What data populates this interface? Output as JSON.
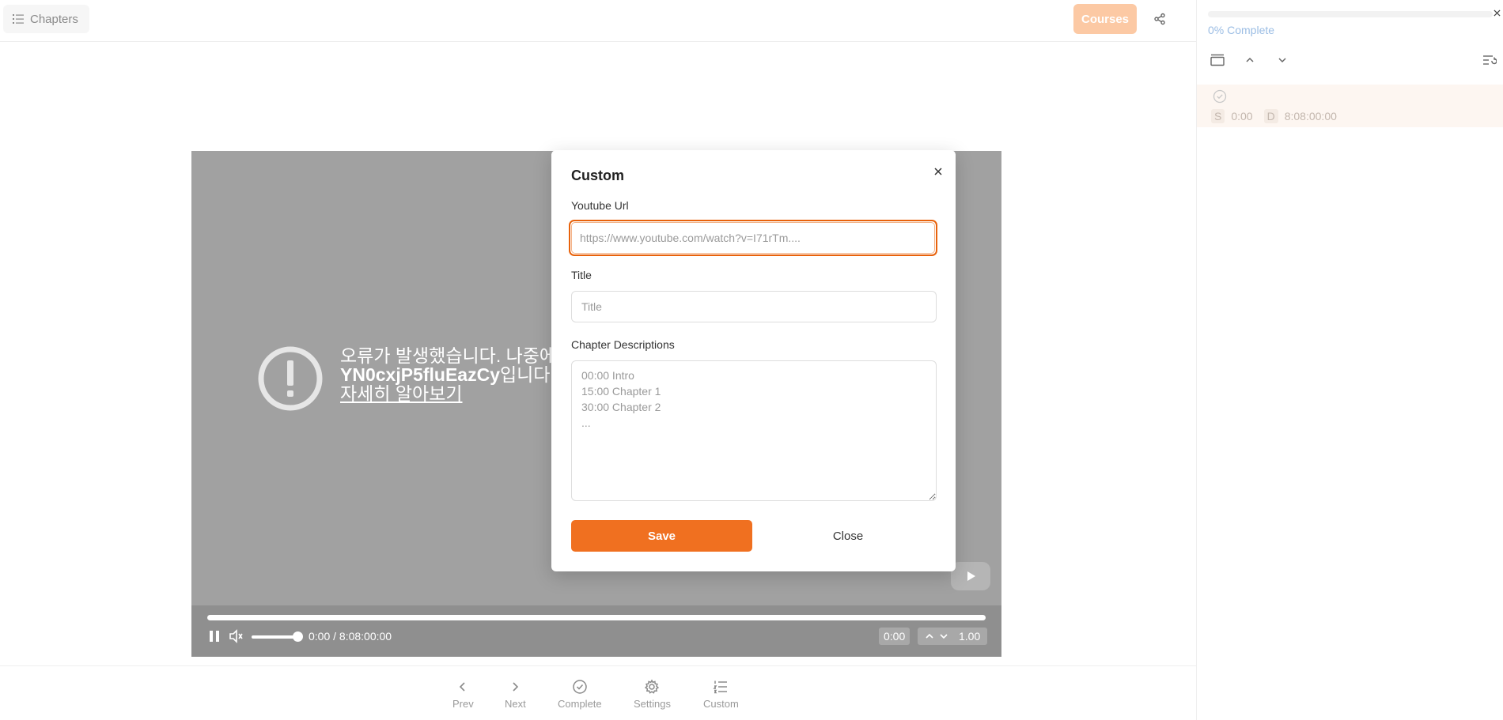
{
  "topbar": {
    "chapters_label": "Chapters",
    "courses_label": "Courses"
  },
  "video": {
    "error_line1": "오류가 발생했습니다. 나중에",
    "error_id": "YN0cxjP5fluEazCy",
    "error_line2_suffix": "입니다.",
    "learn_more": "자세히 알아보기",
    "time_display": "0:00 / 8:08:00:00",
    "current_time": "0:00",
    "speed": "1.00",
    "progress_fraction": 0.0,
    "volume_fraction": 0.9
  },
  "modal": {
    "title": "Custom",
    "url_label": "Youtube Url",
    "url_placeholder": "https://www.youtube.com/watch?v=I71rTm....",
    "url_value": "",
    "title_label": "Title",
    "title_placeholder": "Title",
    "title_value": "",
    "desc_label": "Chapter Descriptions",
    "desc_placeholder": "00:00 Intro\n15:00 Chapter 1\n30:00 Chapter 2\n...",
    "save_label": "Save",
    "close_label": "Close"
  },
  "bottom_nav": {
    "items": [
      {
        "label": "Prev",
        "icon": "chevron-left-icon"
      },
      {
        "label": "Next",
        "icon": "chevron-right-icon"
      },
      {
        "label": "Complete",
        "icon": "check-circle-icon"
      },
      {
        "label": "Settings",
        "icon": "gear-icon"
      },
      {
        "label": "Custom",
        "icon": "list-ordered-icon"
      }
    ]
  },
  "panel": {
    "complete_text": "0% Complete",
    "completion_fraction": 0.0,
    "chapter": {
      "start_tag": "S",
      "start_time": "0:00",
      "duration_tag": "D",
      "duration": "8:08:00:00"
    }
  },
  "colors": {
    "accent": "#f07020",
    "accent_light": "#fcc9a4",
    "complete_text": "#9bbde4",
    "video_bg": "#a1a1a1"
  }
}
